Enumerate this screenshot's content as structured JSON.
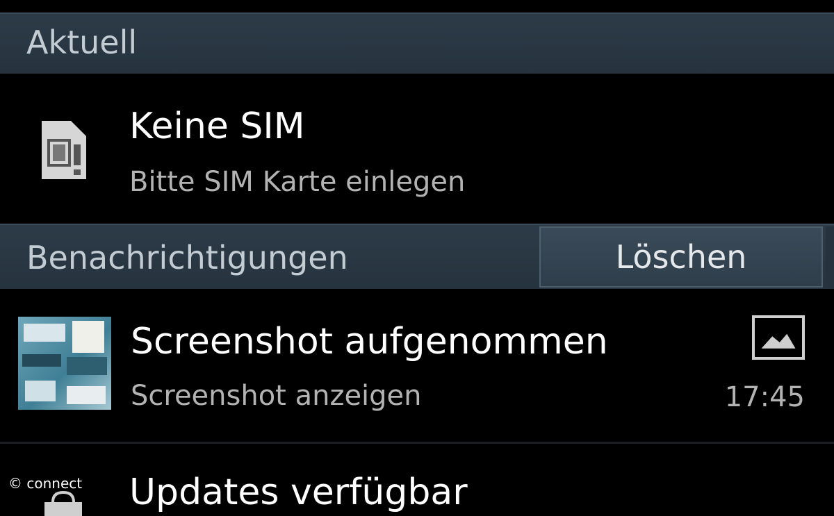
{
  "sections": {
    "current_title": "Aktuell",
    "notifications_title": "Benachrichtigungen",
    "clear_label": "Löschen"
  },
  "sim_notice": {
    "title": "Keine SIM",
    "subtitle": "Bitte SIM Karte einlegen",
    "icon": "sim-card-icon"
  },
  "screenshot_notice": {
    "title": "Screenshot aufgenommen",
    "subtitle": "Screenshot anzeigen",
    "time": "17:45",
    "icon": "picture-icon"
  },
  "update_notice": {
    "title": "Updates verfügbar",
    "icon": "shopping-bag-icon"
  },
  "watermark": "© connect",
  "colors": {
    "header_bg": "#2d3b48",
    "background": "#000000",
    "secondary_text": "#b3b3b3"
  }
}
